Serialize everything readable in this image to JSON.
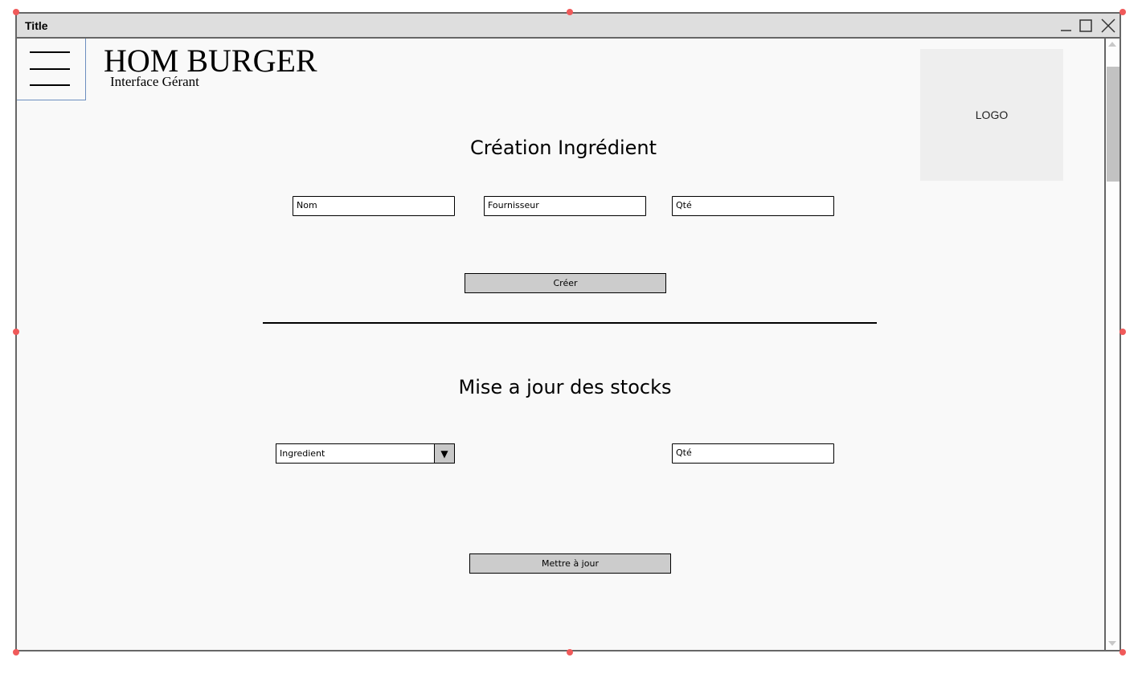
{
  "window": {
    "title": "Title"
  },
  "header": {
    "app_title": "HOM BURGER",
    "app_subtitle": "Interface Gérant",
    "logo_text": "LOGO"
  },
  "creation": {
    "title": "Création Ingrédient",
    "nom_placeholder": "Nom",
    "fournisseur_placeholder": "Fournisseur",
    "qte_placeholder": "Qté",
    "submit_label": "Créer"
  },
  "stock_update": {
    "title": "Mise a jour des stocks",
    "ingredient_select_value": "Ingredient",
    "qte_placeholder": "Qté",
    "submit_label": "Mettre à jour"
  },
  "colors": {
    "window_bg": "#f9f9f9",
    "titlebar_bg": "#dedede",
    "button_bg": "#cccccc",
    "logo_bg": "#eeeeee",
    "selection_handle": "#f05a5a"
  }
}
